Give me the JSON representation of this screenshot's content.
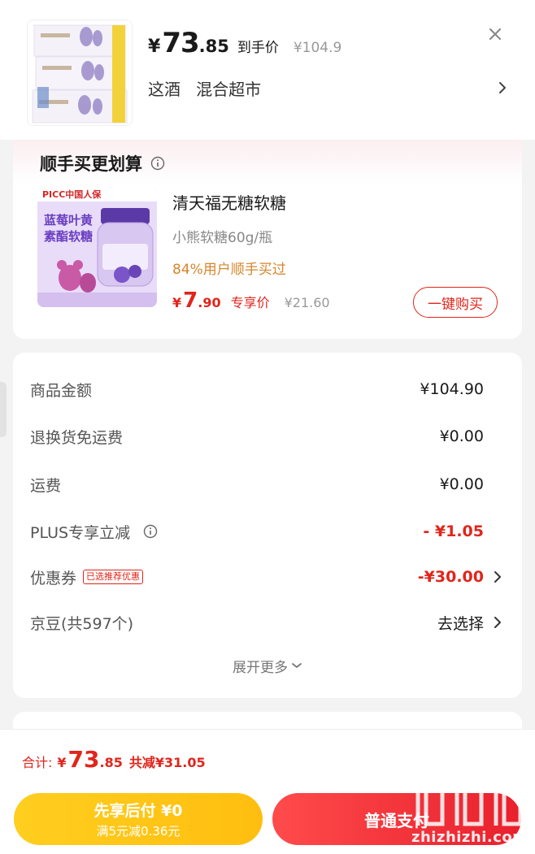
{
  "product": {
    "price_currency": "¥",
    "price_int": "73",
    "price_dec": ".85",
    "price_tag": "到手价",
    "original_price": "¥104.9",
    "shop_name": "这酒   混合超市"
  },
  "upsell": {
    "title": "顺手买更划算",
    "item": {
      "name": "清天福无糖软糖",
      "spec": "小熊软糖60g/瓶",
      "buyers": "84%用户顺手买过",
      "price_currency": "¥",
      "price_int": "7",
      "price_dec": ".90",
      "price_tag": "专享价",
      "original_price": "¥21.60",
      "buy_label": "一键购买",
      "image_text_brand": "PICC中国人保",
      "image_text_line1": "蓝莓叶黄",
      "image_text_line2": "素酯软糖"
    }
  },
  "summary": {
    "rows": [
      {
        "label": "商品金额",
        "value": "¥104.90"
      },
      {
        "label": "退换货免运费",
        "value": "¥0.00"
      },
      {
        "label": "运费",
        "value": "¥0.00"
      },
      {
        "label": "PLUS专享立减",
        "value": "- ¥1.05"
      },
      {
        "label": "优惠券",
        "badge": "已选推荐优惠",
        "value": "-¥30.00"
      },
      {
        "label": "京豆(共597个)",
        "value": "去选择"
      }
    ],
    "expand_label": "展开更多"
  },
  "footer": {
    "total_label": "合计:",
    "total_currency": "¥",
    "total_int": "73",
    "total_dec": ".85",
    "total_saved": "共减¥31.05",
    "pay_later_label": "先享后付 ¥0",
    "pay_later_sub": "满5元减0.36元",
    "pay_now_label": "普通支付"
  },
  "watermark": {
    "text": "zhizhizhi.com"
  },
  "colors": {
    "accent": "#e1251b",
    "pay_later": "#ffc414",
    "orange_text": "#d6862c"
  }
}
